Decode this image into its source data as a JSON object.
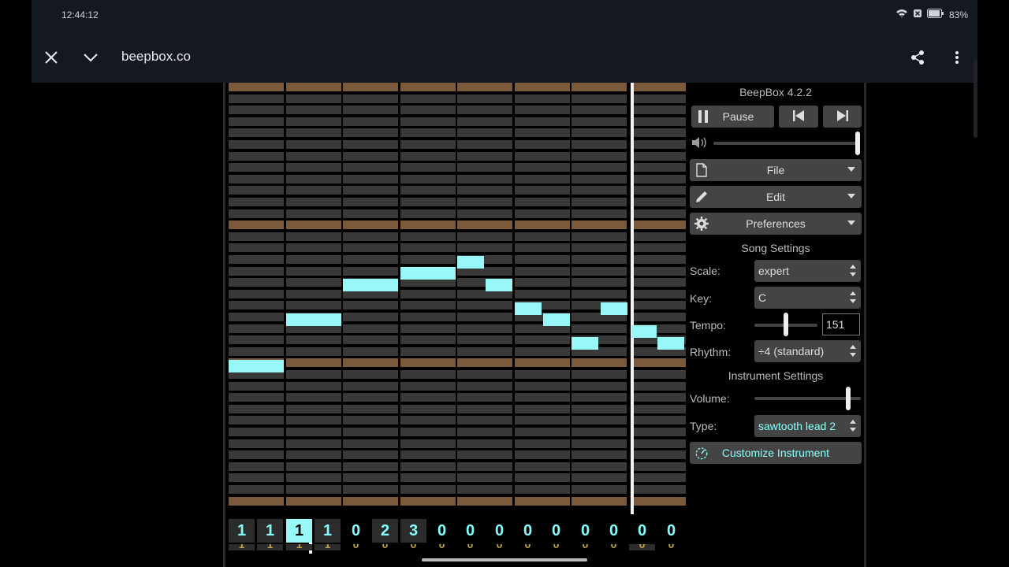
{
  "status": {
    "time": "12:44:12",
    "battery": "83%"
  },
  "browser": {
    "url": "beepbox.co"
  },
  "app": {
    "version": "BeepBox 4.2.2",
    "transport": {
      "pause_label": "Pause"
    },
    "menus": {
      "file": "File",
      "edit": "Edit",
      "preferences": "Preferences"
    },
    "song_settings": {
      "heading": "Song Settings",
      "scale_label": "Scale:",
      "scale_value": "expert",
      "key_label": "Key:",
      "key_value": "C",
      "tempo_label": "Tempo:",
      "tempo_value": "151",
      "rhythm_label": "Rhythm:",
      "rhythm_value": "÷4 (standard)"
    },
    "instrument_settings": {
      "heading": "Instrument Settings",
      "volume_label": "Volume:",
      "volume_level": 0.88,
      "type_label": "Type:",
      "type_value": "sawtooth lead 2",
      "customize_label": "Customize Instrument"
    },
    "master_volume_level": 1.0,
    "tempo_slider_level": 0.5,
    "pattern_row_1": [
      "1",
      "1",
      "1",
      "1",
      "0",
      "2",
      "3",
      "0",
      "0",
      "0",
      "0",
      "0",
      "0",
      "0",
      "0",
      "0"
    ],
    "pattern_row_2": [
      "1",
      "1",
      "1",
      "1",
      "0",
      "0",
      "0",
      "0",
      "0",
      "0",
      "0",
      "0",
      "0",
      "0",
      "0",
      "0"
    ]
  }
}
